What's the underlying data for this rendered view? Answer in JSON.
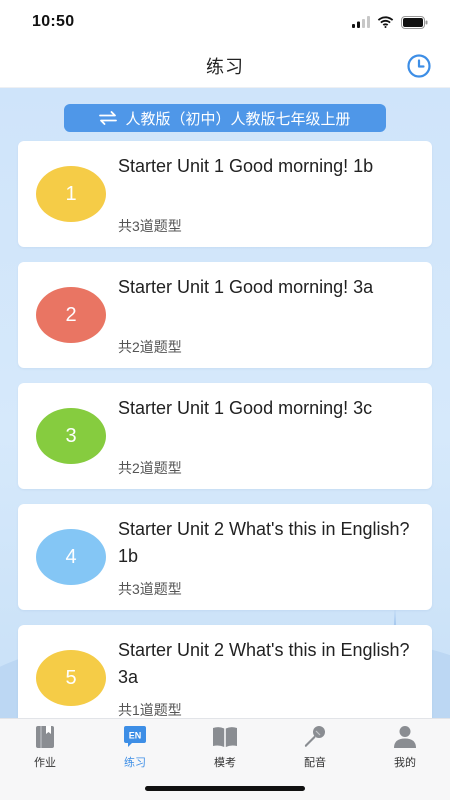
{
  "status_bar": {
    "time": "10:50"
  },
  "header": {
    "title": "练习"
  },
  "textbook_selector": {
    "label": "人教版（初中）人教版七年级上册"
  },
  "exercises": [
    {
      "number": "1",
      "title": "Starter Unit 1 Good morning! 1b",
      "subtitle": "共3道题型",
      "color": "#f5cc47"
    },
    {
      "number": "2",
      "title": "Starter Unit 1 Good morning! 3a",
      "subtitle": "共2道题型",
      "color": "#e97563"
    },
    {
      "number": "3",
      "title": "Starter Unit 1 Good morning! 3c",
      "subtitle": "共2道题型",
      "color": "#86cc3f"
    },
    {
      "number": "4",
      "title": "Starter Unit 2 What's this in English? 1b",
      "subtitle": "共3道题型",
      "color": "#84c6f5"
    },
    {
      "number": "5",
      "title": "Starter Unit 2 What's this in English? 3a",
      "subtitle": "共1道题型",
      "color": "#f5cc47"
    }
  ],
  "tabs": [
    {
      "label": "作业",
      "icon": "homework-book-icon",
      "active": false
    },
    {
      "label": "练习",
      "icon": "practice-en-icon",
      "active": true
    },
    {
      "label": "模考",
      "icon": "mock-exam-book-icon",
      "active": false
    },
    {
      "label": "配音",
      "icon": "dubbing-microphone-icon",
      "active": false
    },
    {
      "label": "我的",
      "icon": "profile-user-icon",
      "active": false
    }
  ],
  "colors": {
    "accent": "#3d8ee6",
    "pill": "#4f97e8",
    "inactive_icon": "#8a8d92"
  }
}
